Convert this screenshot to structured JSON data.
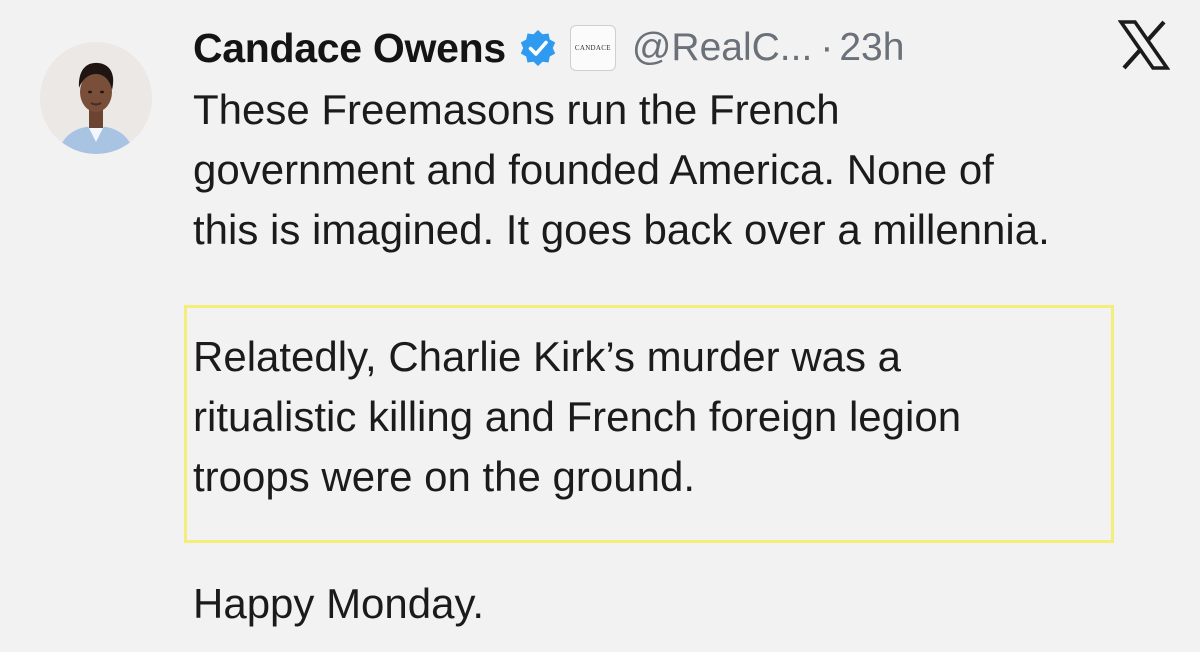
{
  "tweet": {
    "author_name": "Candace Owens",
    "verified_icon": "verified-badge-icon",
    "affiliate_badge_text": "CANDACE",
    "handle": "@RealC...",
    "separator": "·",
    "time": "23h",
    "platform_icon": "x-logo-icon",
    "paragraph1": [
      "These Freemasons run the French",
      "government and founded America. None of",
      "this is imagined. It goes back over a millennia."
    ],
    "paragraph2": [
      "Relatedly, Charlie Kirk’s murder was a",
      "ritualistic killing and French foreign legion",
      "troops were on the ground."
    ],
    "paragraph3": "Happy Monday."
  },
  "colors": {
    "background": "#f3f2f2",
    "verified_blue": "#2f9bf0",
    "highlight_border": "#f3ed7a",
    "handle_gray": "#6a7178"
  }
}
